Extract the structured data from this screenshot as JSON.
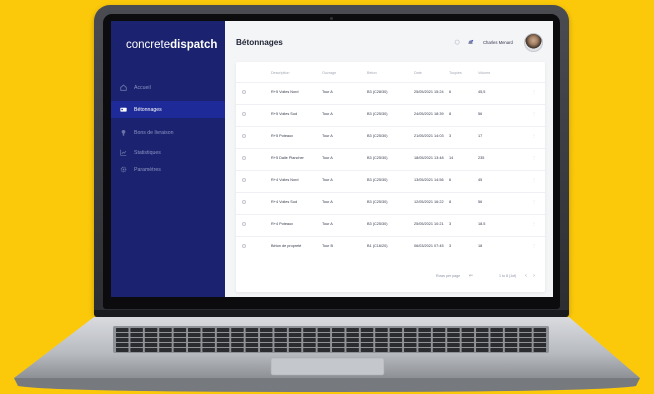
{
  "app": {
    "logo_light": "concrete",
    "logo_bold": "dispatch",
    "page_title": "Bétonnages",
    "user_name": "Charles Menard"
  },
  "sidebar": {
    "items": [
      {
        "label": "Accueil",
        "icon": "home-icon",
        "active": false
      },
      {
        "label": "Bétonnages",
        "icon": "truck-icon",
        "active": true
      },
      {
        "label": "Bons de livraison",
        "icon": "document-icon",
        "active": false
      },
      {
        "label": "Statistiques",
        "icon": "chart-icon",
        "active": false
      },
      {
        "label": "Paramètres",
        "icon": "gear-icon",
        "active": false
      }
    ]
  },
  "table": {
    "headers": [
      "Description",
      "Ouvrage",
      "Béton",
      "Date",
      "Toupies",
      "Volume"
    ],
    "rows": [
      [
        "R+5 Voiles Nord",
        "Tour A",
        "B3 (C28/30)",
        "25/05/2021 15:24",
        "6",
        "45,5"
      ],
      [
        "R+5 Voiles Sud",
        "Tour A",
        "B3 (C25/30)",
        "24/05/2021 18:39",
        "8",
        "56"
      ],
      [
        "R+5 Poteaux",
        "Tour A",
        "B3 (C25/30)",
        "21/05/2021 14:03",
        "3",
        "17"
      ],
      [
        "R+5 Dalle Plancher",
        "Tour A",
        "B3 (C25/30)",
        "18/05/2021 13:48",
        "14",
        "235"
      ],
      [
        "R+4 Voiles Nord",
        "Tour A",
        "B3 (C25/30)",
        "13/05/2021 14:56",
        "6",
        "45"
      ],
      [
        "R+4 Voiles Sud",
        "Tour A",
        "B3 (C25/30)",
        "12/05/2021 16:22",
        "8",
        "56"
      ],
      [
        "R+4 Poteaux",
        "Tour A",
        "B3 (C25/30)",
        "25/05/2021 10:21",
        "3",
        "18.5"
      ],
      [
        "Béton de propreté",
        "Tour B",
        "B1 (C16/20)",
        "06/03/2021 07:45",
        "3",
        "18"
      ]
    ]
  },
  "pagination": {
    "rows_per_page_label": "Rows per page",
    "range_label": "1 to 8 (1of)"
  },
  "colors": {
    "background": "#fcc90a",
    "sidebar": "#1b2370",
    "sidebar_active": "#1d2a98"
  }
}
